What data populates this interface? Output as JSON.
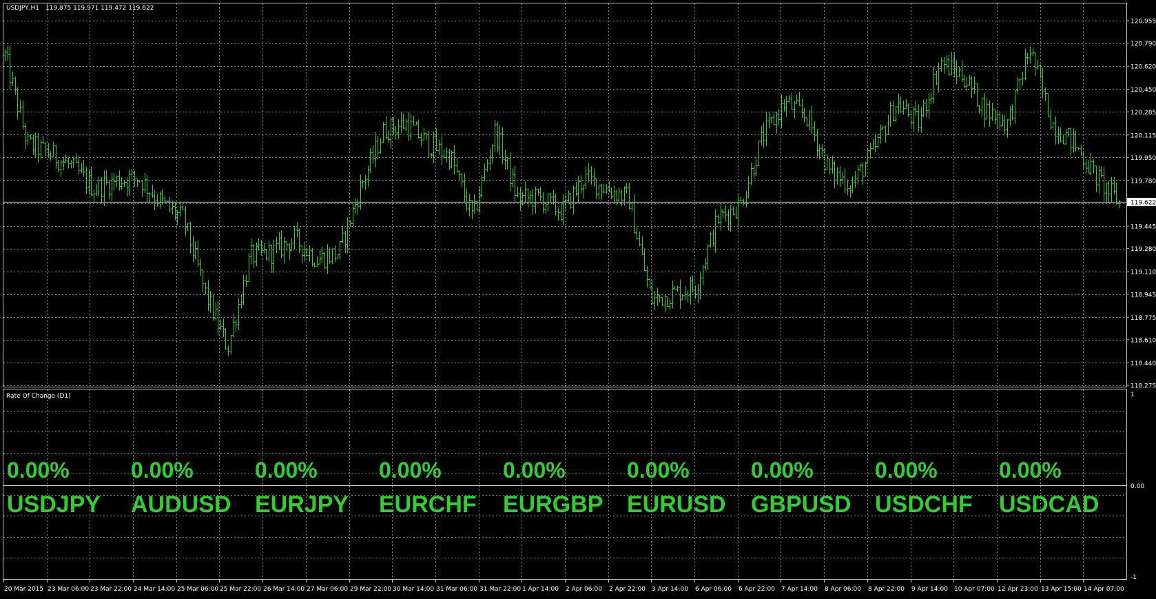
{
  "header": {
    "symbol_timeframe": "USDJPY,H1",
    "ohlc": "119.875 119.971 119.472 119.622"
  },
  "colors": {
    "background": "#000000",
    "grid": "#8a8a8a",
    "candle": "#32cd32",
    "bid_line": "#8c8c8c",
    "text": "#ffffff"
  },
  "main_panel": {
    "price_axis_labels": [
      "120.955",
      "120.790",
      "120.620",
      "120.450",
      "120.285",
      "120.115",
      "119.950",
      "119.780",
      "119.445",
      "119.280",
      "119.110",
      "118.945",
      "118.775",
      "118.610",
      "118.440",
      "118.275"
    ],
    "current_price": "119.622",
    "current_price_value": 119.622
  },
  "indicator_panel": {
    "title": "Rate Of Change (D1)",
    "axis_labels": [
      "1",
      "0.00",
      "-1"
    ],
    "items": [
      {
        "symbol": "USDJPY",
        "change": "0.00%"
      },
      {
        "symbol": "AUDUSD",
        "change": "0.00%"
      },
      {
        "symbol": "EURJPY",
        "change": "0.00%"
      },
      {
        "symbol": "EURCHF",
        "change": "0.00%"
      },
      {
        "symbol": "EURGBP",
        "change": "0.00%"
      },
      {
        "symbol": "EURUSD",
        "change": "0.00%"
      },
      {
        "symbol": "GBPUSD",
        "change": "0.00%"
      },
      {
        "symbol": "USDCHF",
        "change": "0.00%"
      },
      {
        "symbol": "USDCAD",
        "change": "0.00%"
      }
    ]
  },
  "time_axis": {
    "labels": [
      "20 Mar 2015",
      "23 Mar 06:00",
      "23 Mar 22:00",
      "24 Mar 14:00",
      "25 Mar 06:00",
      "25 Mar 22:00",
      "26 Mar 14:00",
      "27 Mar 06:00",
      "29 Mar 22:00",
      "30 Mar 14:00",
      "31 Mar 06:00",
      "31 Mar 22:00",
      "1 Apr 14:00",
      "2 Apr 06:00",
      "2 Apr 22:00",
      "3 Apr 14:00",
      "6 Apr 06:00",
      "6 Apr 22:00",
      "7 Apr 14:00",
      "8 Apr 06:00",
      "8 Apr 22:00",
      "9 Apr 14:00",
      "10 Apr 07:00",
      "12 Apr 23:00",
      "13 Apr 15:00",
      "14 Apr 07:00"
    ]
  },
  "chart_data": {
    "type": "ohlc",
    "symbol": "USDJPY",
    "timeframe": "H1",
    "ylim": [
      118.275,
      120.955
    ],
    "close_path": [
      {
        "t": "20 Mar 2015",
        "v": 120.7
      },
      {
        "t": "20 Mar 2015",
        "v": 120.05
      },
      {
        "t": "23 Mar 06:00",
        "v": 119.98
      },
      {
        "t": "23 Mar 06:00",
        "v": 119.88
      },
      {
        "t": "23 Mar 22:00",
        "v": 119.72
      },
      {
        "t": "24 Mar 14:00",
        "v": 119.78
      },
      {
        "t": "24 Mar 14:00",
        "v": 119.8
      },
      {
        "t": "25 Mar 06:00",
        "v": 119.62
      },
      {
        "t": "25 Mar 06:00",
        "v": 119.5
      },
      {
        "t": "25 Mar 22:00",
        "v": 118.95
      },
      {
        "t": "25 Mar 22:00",
        "v": 118.55
      },
      {
        "t": "26 Mar 14:00",
        "v": 119.22
      },
      {
        "t": "26 Mar 14:00",
        "v": 119.25
      },
      {
        "t": "27 Mar 06:00",
        "v": 119.35
      },
      {
        "t": "27 Mar 06:00",
        "v": 119.2
      },
      {
        "t": "29 Mar 22:00",
        "v": 119.25
      },
      {
        "t": "29 Mar 22:00",
        "v": 119.75
      },
      {
        "t": "30 Mar 14:00",
        "v": 120.15
      },
      {
        "t": "30 Mar 14:00",
        "v": 120.2
      },
      {
        "t": "31 Mar 06:00",
        "v": 120.05
      },
      {
        "t": "31 Mar 06:00",
        "v": 119.95
      },
      {
        "t": "31 Mar 22:00",
        "v": 119.5
      },
      {
        "t": "31 Mar 22:00",
        "v": 120.15
      },
      {
        "t": "1 Apr 14:00",
        "v": 119.65
      },
      {
        "t": "1 Apr 14:00",
        "v": 119.65
      },
      {
        "t": "2 Apr 06:00",
        "v": 119.55
      },
      {
        "t": "2 Apr 06:00",
        "v": 119.8
      },
      {
        "t": "2 Apr 22:00",
        "v": 119.72
      },
      {
        "t": "2 Apr 22:00",
        "v": 119.65
      },
      {
        "t": "3 Apr 14:00",
        "v": 118.9
      },
      {
        "t": "3 Apr 14:00",
        "v": 118.95
      },
      {
        "t": "6 Apr 06:00",
        "v": 119.0
      },
      {
        "t": "6 Apr 06:00",
        "v": 119.5
      },
      {
        "t": "6 Apr 22:00",
        "v": 119.6
      },
      {
        "t": "6 Apr 22:00",
        "v": 120.1
      },
      {
        "t": "7 Apr 14:00",
        "v": 120.35
      },
      {
        "t": "7 Apr 14:00",
        "v": 120.25
      },
      {
        "t": "8 Apr 06:00",
        "v": 119.85
      },
      {
        "t": "8 Apr 06:00",
        "v": 119.75
      },
      {
        "t": "8 Apr 22:00",
        "v": 120.0
      },
      {
        "t": "8 Apr 22:00",
        "v": 120.35
      },
      {
        "t": "9 Apr 14:00",
        "v": 120.2
      },
      {
        "t": "9 Apr 14:00",
        "v": 120.65
      },
      {
        "t": "10 Apr 07:00",
        "v": 120.55
      },
      {
        "t": "10 Apr 07:00",
        "v": 120.3
      },
      {
        "t": "12 Apr 23:00",
        "v": 120.2
      },
      {
        "t": "12 Apr 23:00",
        "v": 120.75
      },
      {
        "t": "13 Apr 15:00",
        "v": 120.2
      },
      {
        "t": "13 Apr 15:00",
        "v": 120.05
      },
      {
        "t": "14 Apr 07:00",
        "v": 119.8
      },
      {
        "t": "14 Apr 07:00",
        "v": 119.62
      }
    ]
  }
}
